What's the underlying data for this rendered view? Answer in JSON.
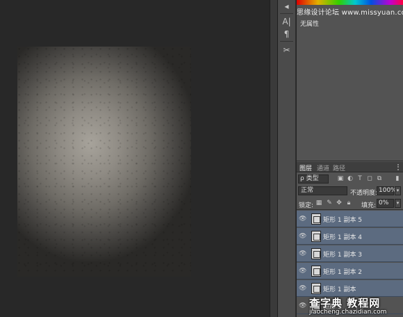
{
  "watermark_top": "思缘设计论坛 www.missyuan.com",
  "tools": {
    "type_tool": "A|",
    "paragraph": "¶",
    "tools_icon": "tool-settings-icon"
  },
  "properties": {
    "empty_text": "无属性"
  },
  "layers_panel": {
    "tabs": [
      "图层",
      "通道",
      "路径"
    ],
    "filter_kind": "ρ 类型",
    "blend_mode": "正常",
    "opacity_label": "不透明度:",
    "opacity_value": "100%",
    "lock_label": "锁定:",
    "fill_label": "填充:",
    "fill_value": "0%",
    "layers": [
      {
        "name": "矩形 1 副本 5",
        "selected": true
      },
      {
        "name": "矩形 1 副本 4",
        "selected": true
      },
      {
        "name": "矩形 1 副本 3",
        "selected": true
      },
      {
        "name": "矩形 1 副本 2",
        "selected": true
      },
      {
        "name": "矩形 1 副本",
        "selected": true
      },
      {
        "name": "矩形 1",
        "selected": false
      }
    ]
  },
  "watermark_bottom": {
    "brand": "查字典 教程网",
    "url": "jiaocheng.chazidian.com"
  },
  "colors": {
    "selected_layer_bg": "#5c6b80",
    "panel_bg": "#535353",
    "workspace_bg": "#282828"
  }
}
